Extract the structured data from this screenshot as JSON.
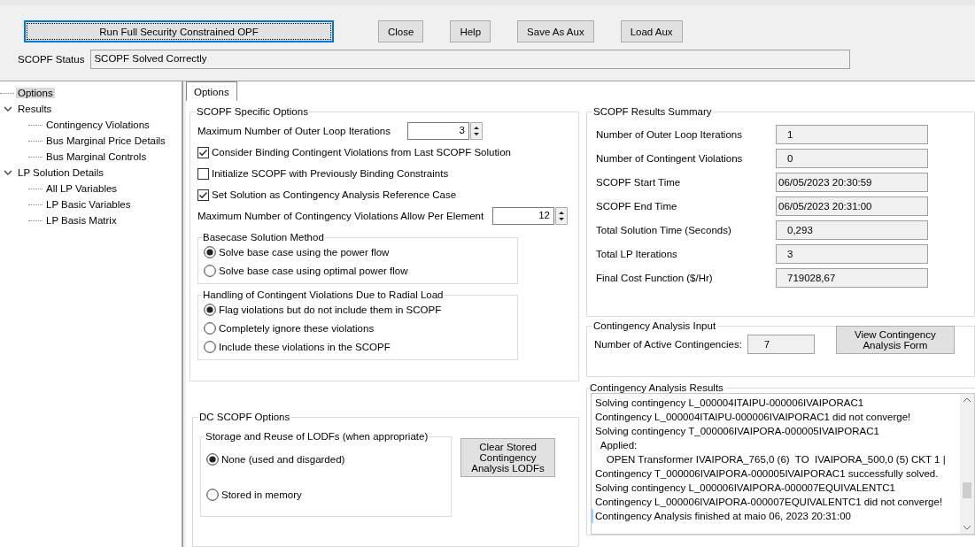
{
  "toolbar": {
    "buttons": [
      {
        "label": "Run Full Security Constrained OPF",
        "focused": true
      },
      {
        "label": "Close",
        "focused": false
      },
      {
        "label": "Help",
        "focused": false
      },
      {
        "label": "Save As Aux",
        "focused": false
      },
      {
        "label": "Load Aux",
        "focused": false
      }
    ]
  },
  "status": {
    "label": "SCOPF Status",
    "value": "SCOPF Solved Correctly"
  },
  "tree": [
    {
      "label": "Options",
      "selected": true
    },
    {
      "label": "Results",
      "selected": false,
      "expanded": true,
      "children": [
        {
          "label": "Contingency Violations",
          "selected": false
        },
        {
          "label": "Bus Marginal Price Details",
          "selected": false
        },
        {
          "label": "Bus Marginal Controls",
          "selected": false
        }
      ]
    },
    {
      "label": "LP Solution Details",
      "selected": false,
      "expanded": true,
      "children": [
        {
          "label": "All LP Variables",
          "selected": false
        },
        {
          "label": "LP Basic Variables",
          "selected": false
        },
        {
          "label": "LP Basis Matrix",
          "selected": false
        }
      ]
    }
  ],
  "tabs": [
    {
      "label": "Options",
      "selected": true
    }
  ],
  "specific_options": {
    "title": "SCOPF Specific Options",
    "items": [
      {
        "kind": "spinner",
        "label": "Maximum Number of Outer Loop Iterations",
        "value": "3"
      },
      {
        "kind": "checkbox",
        "label": "Consider Binding Contingent Violations from Last SCOPF Solution",
        "checked": true
      },
      {
        "kind": "checkbox",
        "label": "Initialize SCOPF with Previously Binding Constraints",
        "checked": false
      },
      {
        "kind": "checkbox",
        "label": "Set Solution as Contingency Analysis Reference Case",
        "checked": true
      },
      {
        "kind": "spinner",
        "label": "Maximum Number of Contingency Violations Allow Per Element",
        "value": "12"
      }
    ],
    "groups": [
      {
        "title": "Basecase Solution Method",
        "options": [
          {
            "label": "Solve base case using the power flow",
            "selected": true
          },
          {
            "label": "Solve base case using optimal power flow",
            "selected": false
          }
        ]
      },
      {
        "title": "Handling of Contingent Violations Due to Radial Load",
        "options": [
          {
            "label": "Flag violations but do not include them in SCOPF",
            "selected": true
          },
          {
            "label": "Completely ignore these violations",
            "selected": false
          },
          {
            "label": "Include these violations in the SCOPF",
            "selected": false
          }
        ]
      }
    ]
  },
  "dc_options": {
    "title": "DC SCOPF Options",
    "storage": {
      "title": "Storage and Reuse of LODFs (when appropriate)",
      "options": [
        {
          "label": "None (used and disgarded)",
          "selected": true
        },
        {
          "label": "Stored in memory",
          "selected": false
        }
      ]
    },
    "button": "Clear Stored Contingency Analysis LODFs"
  },
  "summary": {
    "title": "SCOPF Results Summary",
    "rows": [
      {
        "label": "Number of Outer Loop Iterations",
        "value": "1"
      },
      {
        "label": "Number of Contingent Violations",
        "value": "0"
      },
      {
        "label": "SCOPF Start Time",
        "value": "06/05/2023 20:30:59"
      },
      {
        "label": "SCOPF End Time",
        "value": "06/05/2023 20:31:00"
      },
      {
        "label": "Total Solution Time (Seconds)",
        "value": "0,293"
      },
      {
        "label": "Total LP Iterations",
        "value": "3"
      },
      {
        "label": "Final Cost Function ($/Hr)",
        "value": "719028,67"
      }
    ]
  },
  "ca_input": {
    "title": "Contingency Analysis Input",
    "label": "Number of Active Contingencies:",
    "value": "7",
    "button": "View Contingency Analysis Form"
  },
  "ca_results": {
    "title": "Contingency Analysis Results",
    "lines": [
      "Solving contingency L_000004ITAIPU-000006IVAIPORAC1",
      "Contingency L_000004ITAIPU-000006IVAIPORAC1 did not converge!",
      "Solving contingency T_000006IVAIPORA-000005IVAIPORAC1",
      "  Applied:",
      "    OPEN Transformer IVAIPORA_765,0 (6)  TO  IVAIPORA_500,0 (5) CKT 1 |",
      "Contingency T_000006IVAIPORA-000005IVAIPORAC1 successfully solved.",
      "Solving contingency L_000006IVAIPORA-000007EQUIVALENTC1",
      "Contingency L_000006IVAIPORA-000007EQUIVALENTC1 did not converge!",
      "Contingency Analysis finished at maio 06, 2023 20:31:00"
    ]
  }
}
